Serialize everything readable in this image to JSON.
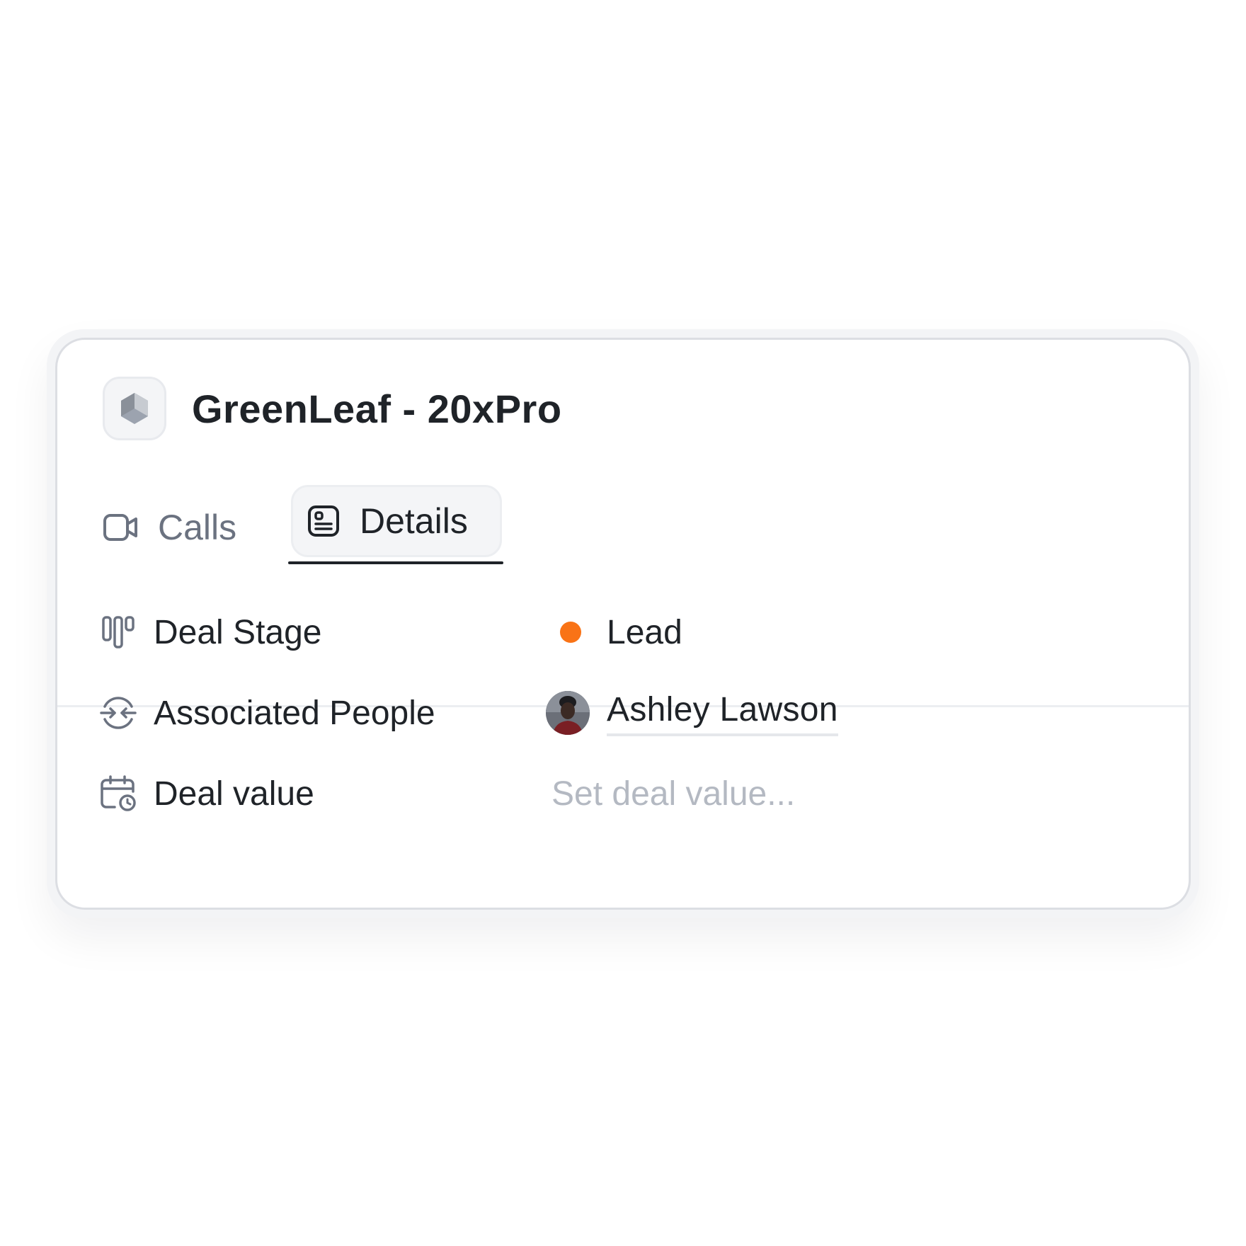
{
  "deal": {
    "title": "GreenLeaf - 20xPro",
    "logo_icon": "cube-icon"
  },
  "tabs": [
    {
      "label": "Calls",
      "icon": "video-camera-icon",
      "active": false
    },
    {
      "label": "Details",
      "icon": "details-card-icon",
      "active": true
    }
  ],
  "fields": {
    "deal_stage": {
      "label": "Deal Stage",
      "icon": "kanban-columns-icon",
      "value": "Lead",
      "status_color": "#f97316"
    },
    "associated_people": {
      "label": "Associated People",
      "icon": "merge-arrows-icon",
      "person_name": "Ashley Lawson"
    },
    "deal_value": {
      "label": "Deal value",
      "icon": "calendar-clock-icon",
      "placeholder": "Set deal value..."
    }
  },
  "colors": {
    "text_primary": "#1f2328",
    "text_muted": "#6b7280",
    "placeholder": "#b4b9c2",
    "card_border": "#dcdee3",
    "accent_lead": "#f97316"
  }
}
